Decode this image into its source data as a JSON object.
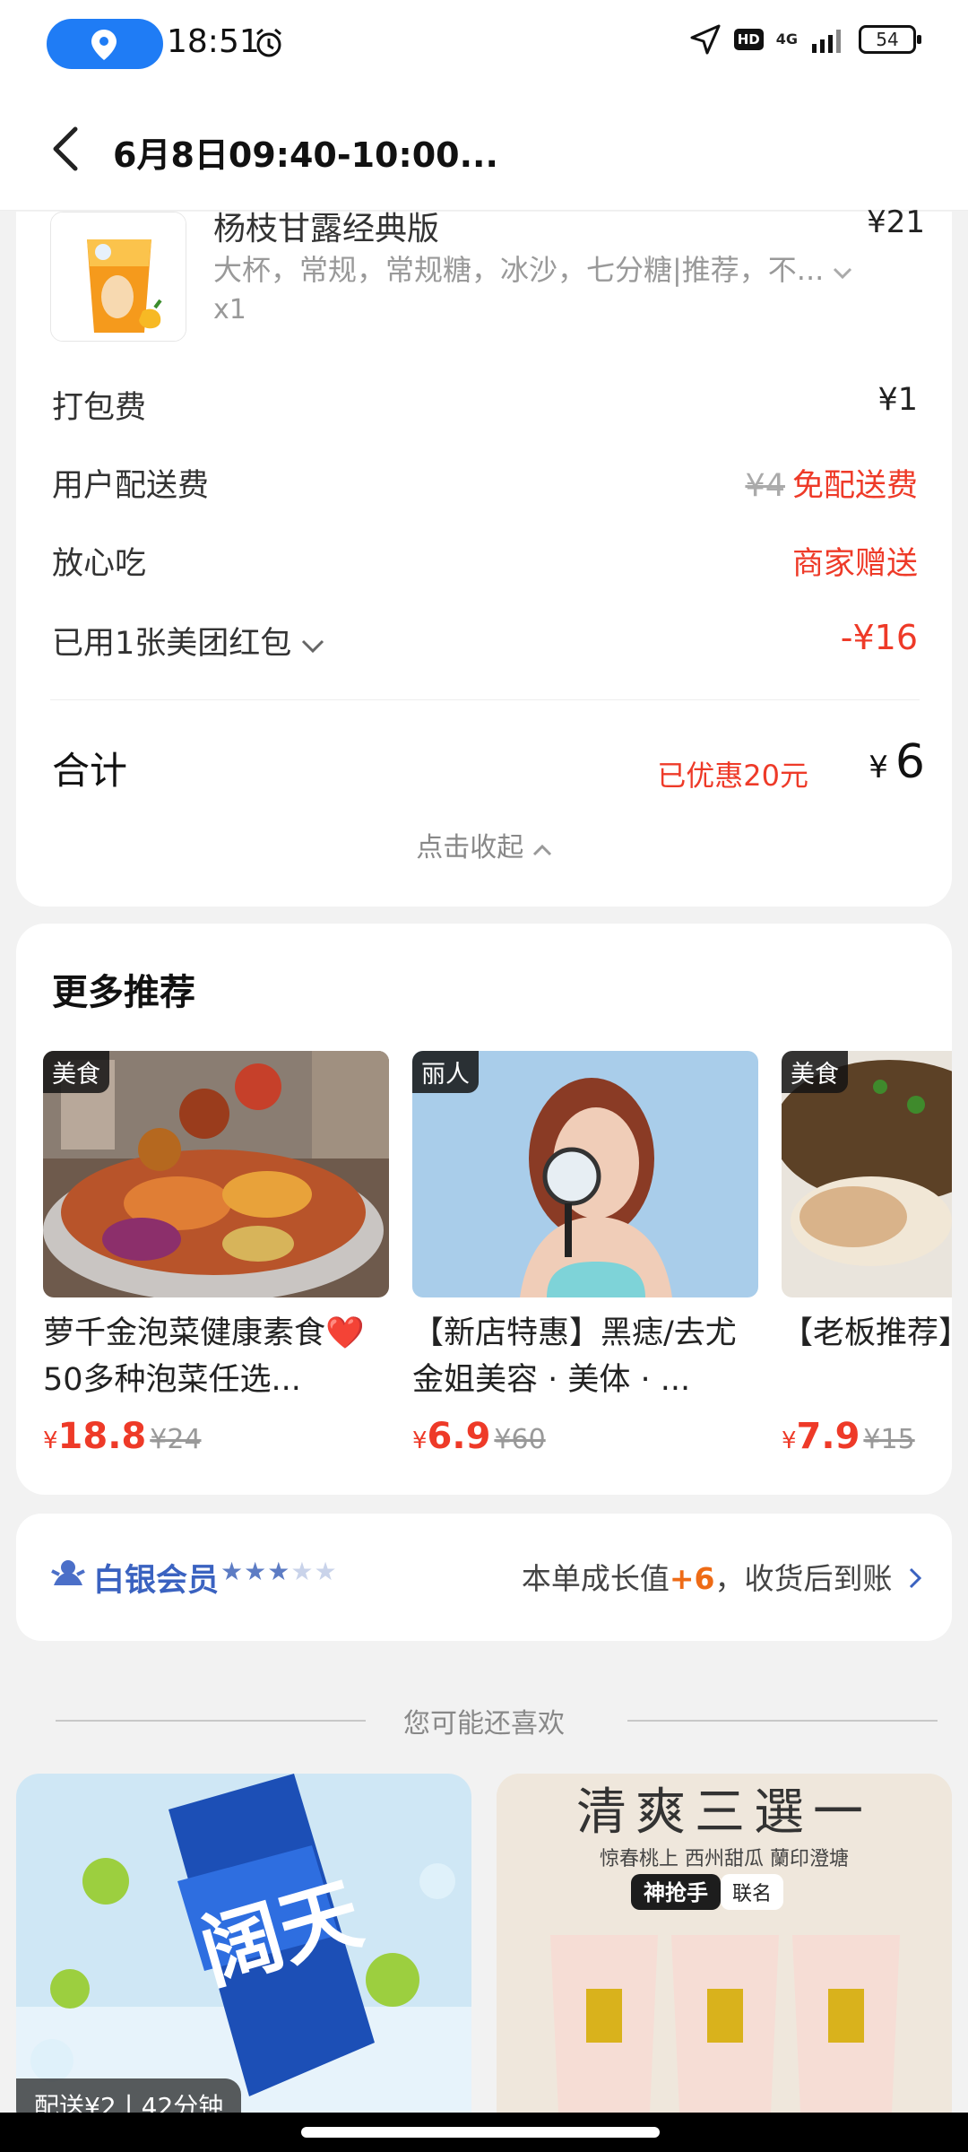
{
  "status_bar": {
    "time": "18:51",
    "network": "4G",
    "hd": "HD",
    "battery": "54"
  },
  "header": {
    "title": "6月8日09:40-10:00..."
  },
  "order": {
    "item": {
      "name": "杨枝甘露经典版",
      "price": "¥21",
      "spec": "大杯，常规，常规糖，冰沙，七分糖|推荐，不...",
      "qty": "x1"
    },
    "packing_fee": {
      "label": "打包费",
      "value": "¥1"
    },
    "delivery_fee": {
      "label": "用户配送费",
      "original": "¥4",
      "value": "免配送费"
    },
    "safe_eat": {
      "label": "放心吃",
      "value": "商家赠送"
    },
    "coupon": {
      "label": "已用1张美团红包",
      "value": "-¥16"
    },
    "total": {
      "label": "合计",
      "saved": "已优惠20元",
      "currency": "¥",
      "value": "6"
    },
    "collapse_label": "点击收起"
  },
  "recommend": {
    "title": "更多推荐",
    "items": [
      {
        "tag": "美食",
        "name": "萝千金泡菜健康素食❤️50多种泡菜任选...",
        "currency": "¥",
        "price": "18.8",
        "old_price": "¥24"
      },
      {
        "tag": "丽人",
        "name": "【新店特惠】黑痣/去尤 金姐美容 · 美体 · ...",
        "currency": "¥",
        "price": "6.9",
        "old_price": "¥60"
      },
      {
        "tag": "美食",
        "name": "【老板推荐】锅烧卤粉",
        "currency": "¥",
        "price": "7.9",
        "old_price": "¥15"
      }
    ]
  },
  "member": {
    "title": "白银会员",
    "stars_filled": 3,
    "stars_total": 5,
    "text_before": "本单成长值",
    "growth": "+6",
    "text_after": "，收货后到账",
    "accent_color": "#3a62c0"
  },
  "you_may_like": {
    "title": "您可能还喜欢",
    "feed1": {
      "brand": "阔天",
      "badge": "配送¥2丨42分钟"
    },
    "feed2": {
      "headline": "清爽三選一",
      "sub": "惊春桃上 西州甜瓜 蘭印澄塘",
      "brand": "神抢手",
      "collab": "联名"
    }
  },
  "colors": {
    "accent_red": "#ee3a28",
    "member_blue": "#3a62c0",
    "location_blue": "#1f7cf5"
  }
}
